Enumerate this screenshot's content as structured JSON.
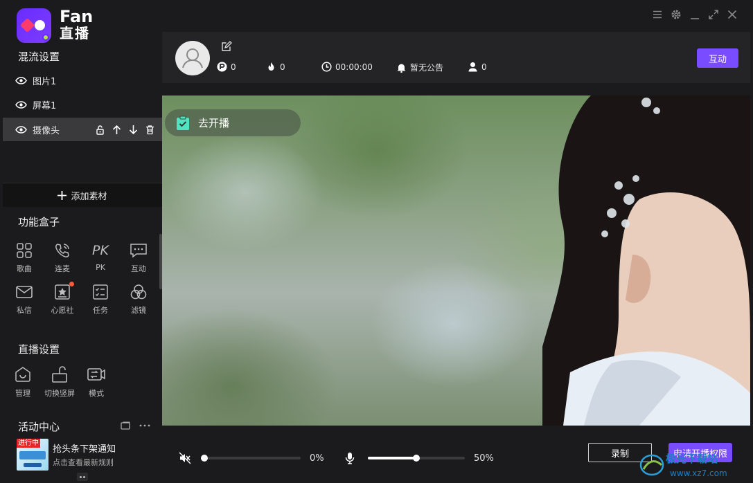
{
  "app": {
    "brand_line1": "Fan",
    "brand_line2": "直播"
  },
  "mix": {
    "title": "混流设置",
    "layers": [
      {
        "label": "图片1",
        "visible": true,
        "active": false
      },
      {
        "label": "屏幕1",
        "visible": true,
        "active": false
      },
      {
        "label": "摄像头",
        "visible": true,
        "active": true
      }
    ],
    "add_material": "添加素材"
  },
  "toolbox": {
    "title": "功能盒子",
    "items": [
      {
        "label": "歌曲",
        "icon": "grid-icon"
      },
      {
        "label": "连麦",
        "icon": "phone-icon"
      },
      {
        "label": "PK",
        "icon": "pk-icon",
        "glyph": "PK"
      },
      {
        "label": "互动",
        "icon": "chat-icon"
      },
      {
        "label": "私信",
        "icon": "mail-icon"
      },
      {
        "label": "心愿社",
        "icon": "wish-icon",
        "has_notification": true
      },
      {
        "label": "任务",
        "icon": "checklist-icon"
      },
      {
        "label": "滤镜",
        "icon": "filter-icon"
      }
    ]
  },
  "live_settings": {
    "title": "直播设置",
    "items": [
      {
        "label": "管理",
        "icon": "home-icon"
      },
      {
        "label": "切换竖屏",
        "icon": "rotate-icon"
      },
      {
        "label": "模式",
        "icon": "camera-switch-icon"
      }
    ]
  },
  "activity": {
    "title": "活动中心",
    "notice": {
      "tag": "进行中",
      "title": "抢头条下架通知",
      "subtitle": "点击查看最新规则"
    }
  },
  "infobar": {
    "coins": "0",
    "heat": "0",
    "duration": "00:00:00",
    "announcement": "暂无公告",
    "viewers": "0",
    "interact_label": "互动"
  },
  "preview": {
    "go_live_label": "去开播"
  },
  "bottom": {
    "speaker_muted": true,
    "speaker_volume_pct": 0,
    "speaker_volume_label": "0%",
    "mic_volume_pct": 50,
    "mic_volume_label": "50%",
    "record_label": "录制",
    "apply_label": "申请开播权限"
  },
  "watermark": {
    "text": "极光下载站",
    "url": "www.xz7.com"
  },
  "colors": {
    "accent": "#7a4cff",
    "sidebar_bg": "#1b1b1d",
    "panel_bg": "#242427",
    "active_row": "#3a3a3d"
  }
}
